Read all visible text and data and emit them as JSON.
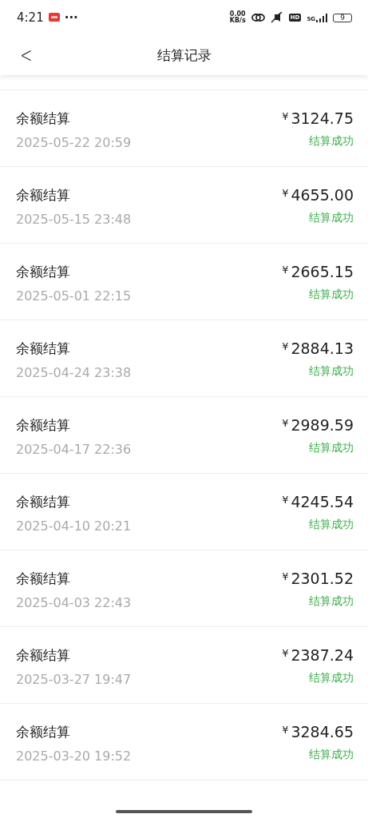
{
  "status_bar": {
    "time": "4:21",
    "more": "···",
    "speed_value": "0.00",
    "speed_unit": "KB/s",
    "hd": "HD",
    "network": "5G",
    "battery": "9"
  },
  "header": {
    "back": "<",
    "title": "结算记录"
  },
  "records": [
    {
      "title": "余额结算",
      "time": "2025-05-22 20:59",
      "currency": "¥",
      "amount": "3124.75",
      "status": "结算成功",
      "kind": "success"
    },
    {
      "title": "余额结算",
      "time": "2025-05-15 23:48",
      "currency": "¥",
      "amount": "4655.00",
      "status": "结算成功",
      "kind": "success"
    },
    {
      "title": "余额结算",
      "time": "2025-05-01 22:15",
      "currency": "¥",
      "amount": "2665.15",
      "status": "结算成功",
      "kind": "success"
    },
    {
      "title": "余额结算",
      "time": "2025-04-24 23:38",
      "currency": "¥",
      "amount": "2884.13",
      "status": "结算成功",
      "kind": "success"
    },
    {
      "title": "余额结算",
      "time": "2025-04-17 22:36",
      "currency": "¥",
      "amount": "2989.59",
      "status": "结算成功",
      "kind": "success"
    },
    {
      "title": "余额结算",
      "time": "2025-04-10 20:21",
      "currency": "¥",
      "amount": "4245.54",
      "status": "结算成功",
      "kind": "success"
    },
    {
      "title": "余额结算",
      "time": "2025-04-03 22:43",
      "currency": "¥",
      "amount": "2301.52",
      "status": "结算成功",
      "kind": "success"
    },
    {
      "title": "余额结算",
      "time": "2025-03-27 19:47",
      "currency": "¥",
      "amount": "2387.24",
      "status": "结算成功",
      "kind": "success"
    },
    {
      "title": "余额结算",
      "time": "2025-03-20 19:52",
      "currency": "¥",
      "amount": "3284.65",
      "status": "结算成功",
      "kind": "success"
    }
  ]
}
